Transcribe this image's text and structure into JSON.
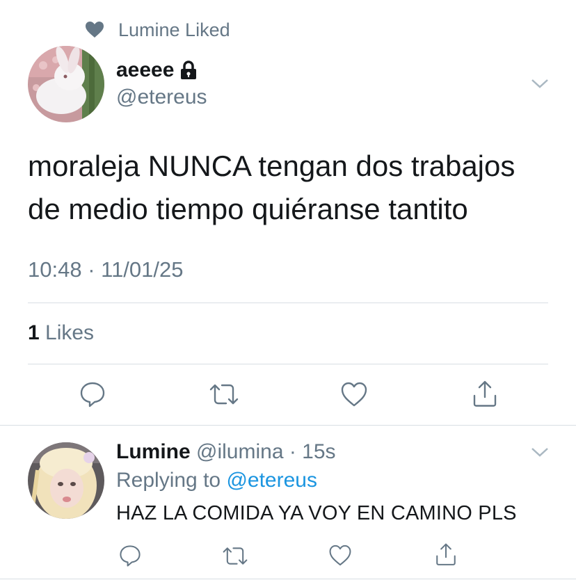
{
  "social_context": {
    "text": "Lumine Liked"
  },
  "tweet": {
    "display_name": "aeeee",
    "handle": "@etereus",
    "text_line1": "moraleja NUNCA tengan dos trabajos",
    "text_line2": "de medio tiempo quiéranse tantito",
    "timestamp": "10:48 · 11/01/25",
    "likes_count": "1",
    "likes_label": " Likes"
  },
  "reply": {
    "display_name": "Lumine",
    "handle": "@ilumina",
    "time": "· 15s",
    "replying_prefix": "Replying to ",
    "replying_to": "@etereus",
    "text": "HAZ LA COMIDA YA VOY EN CAMINO PLS"
  },
  "icons": [
    "heart-icon",
    "lock-icon",
    "chevron-down-icon",
    "reply-icon",
    "retweet-icon",
    "like-icon",
    "share-icon"
  ],
  "colors": {
    "secondary_text": "#657786",
    "link": "#1b95e0",
    "divider": "#d8dee3"
  }
}
